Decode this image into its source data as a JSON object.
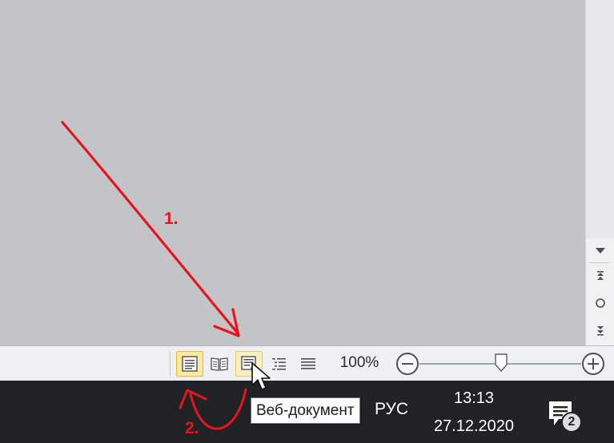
{
  "status_bar": {
    "views": [
      {
        "name": "Разметка страницы",
        "icon": "print-layout-icon",
        "state": "active"
      },
      {
        "name": "Режим чтения",
        "icon": "full-screen-reading-icon",
        "state": "normal"
      },
      {
        "name": "Веб-документ",
        "icon": "web-layout-icon",
        "state": "hover"
      },
      {
        "name": "Структура",
        "icon": "outline-icon",
        "state": "normal"
      },
      {
        "name": "Черновик",
        "icon": "draft-icon",
        "state": "normal"
      }
    ],
    "zoom_label": "100%",
    "zoom_percent": 100
  },
  "tooltip": {
    "text": "Веб-документ"
  },
  "taskbar": {
    "language": "РУС",
    "time": "13:13",
    "date": "27.12.2020",
    "notification_count": "2"
  },
  "annotations": {
    "step1": "1.",
    "step2": "2.",
    "color": "#e8141b"
  },
  "colors": {
    "document_bg": "#c3c4c8",
    "statusbar_bg": "#eef0f3",
    "taskbar_bg": "#202226",
    "active_view_bg": "#fde89b"
  }
}
